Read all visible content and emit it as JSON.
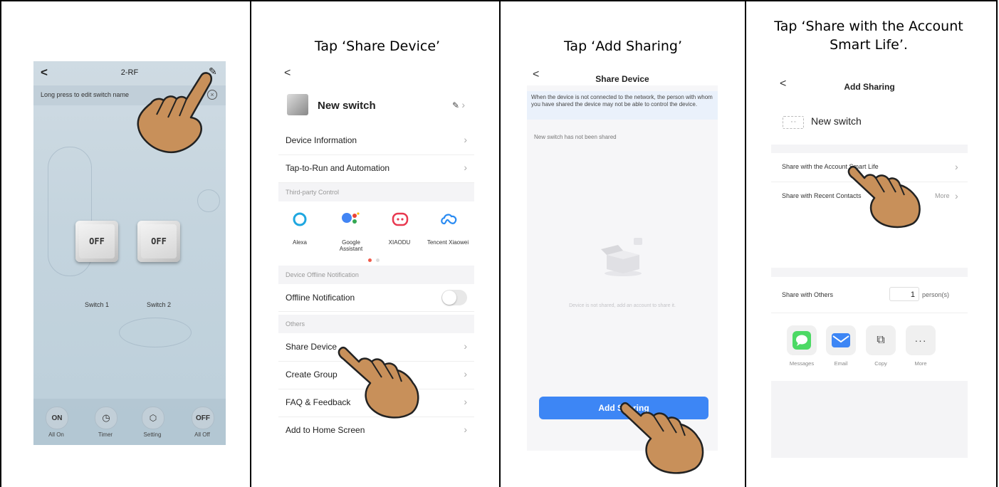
{
  "captions": {
    "panel2": "Tap ‘Share Device’",
    "panel3": "Tap ‘Add Sharing’",
    "panel4_line1": "Tap ‘Share with the Account",
    "panel4_line2": "Smart Life’."
  },
  "panel1": {
    "back": "<",
    "title": "2-RF",
    "hint": "Long press to edit switch name",
    "switch1_state": "OFF",
    "switch2_state": "OFF",
    "switch1_label": "Switch 1",
    "switch2_label": "Switch 2",
    "bottom": [
      {
        "icon": "ON",
        "label": "All On"
      },
      {
        "icon": "◷",
        "label": "Timer"
      },
      {
        "icon": "⬡",
        "label": "Setting"
      },
      {
        "icon": "OFF",
        "label": "All Off"
      }
    ]
  },
  "panel2": {
    "back": "<",
    "device_name": "New switch",
    "rows_top": [
      "Device Information",
      "Tap-to-Run and Automation"
    ],
    "third_party_header": "Third-party Control",
    "third_party": [
      "Alexa",
      "Google Assistant",
      "XIAODU",
      "Tencent Xiaowei"
    ],
    "offline_header": "Device Offline Notification",
    "offline_label": "Offline Notification",
    "others_header": "Others",
    "rows_others": [
      "Share Device",
      "Create Group",
      "FAQ & Feedback",
      "Add to Home Screen"
    ],
    "colors": {
      "alexa": "#1fa7e0",
      "google_blue": "#4285f4",
      "xiaodu": "#e8384f",
      "tencent": "#2a8bf2"
    }
  },
  "panel3": {
    "back": "<",
    "title": "Share Device",
    "notice": "When the device is not connected to the network, the person with whom you have shared the device may not be able to control the device.",
    "not_shared": "New switch has not been shared",
    "empty_hint": "Device is not shared, add an account to share it.",
    "button": "Add Sharing",
    "colors": {
      "button": "#3d86f5",
      "notice_bg": "#eaf1fb"
    }
  },
  "panel4": {
    "back": "<",
    "title": "Add Sharing",
    "device_name": "New switch",
    "share_account": "Share with the Account Smart Life",
    "share_recent": "Share with Recent Contacts",
    "more": "More",
    "share_others": "Share with Others",
    "count": "1",
    "unit": "person(s)",
    "apps": [
      "Messages",
      "Email",
      "Copy",
      "More"
    ],
    "colors": {
      "messages": "#4cd964",
      "email": "#3d86f5"
    }
  }
}
